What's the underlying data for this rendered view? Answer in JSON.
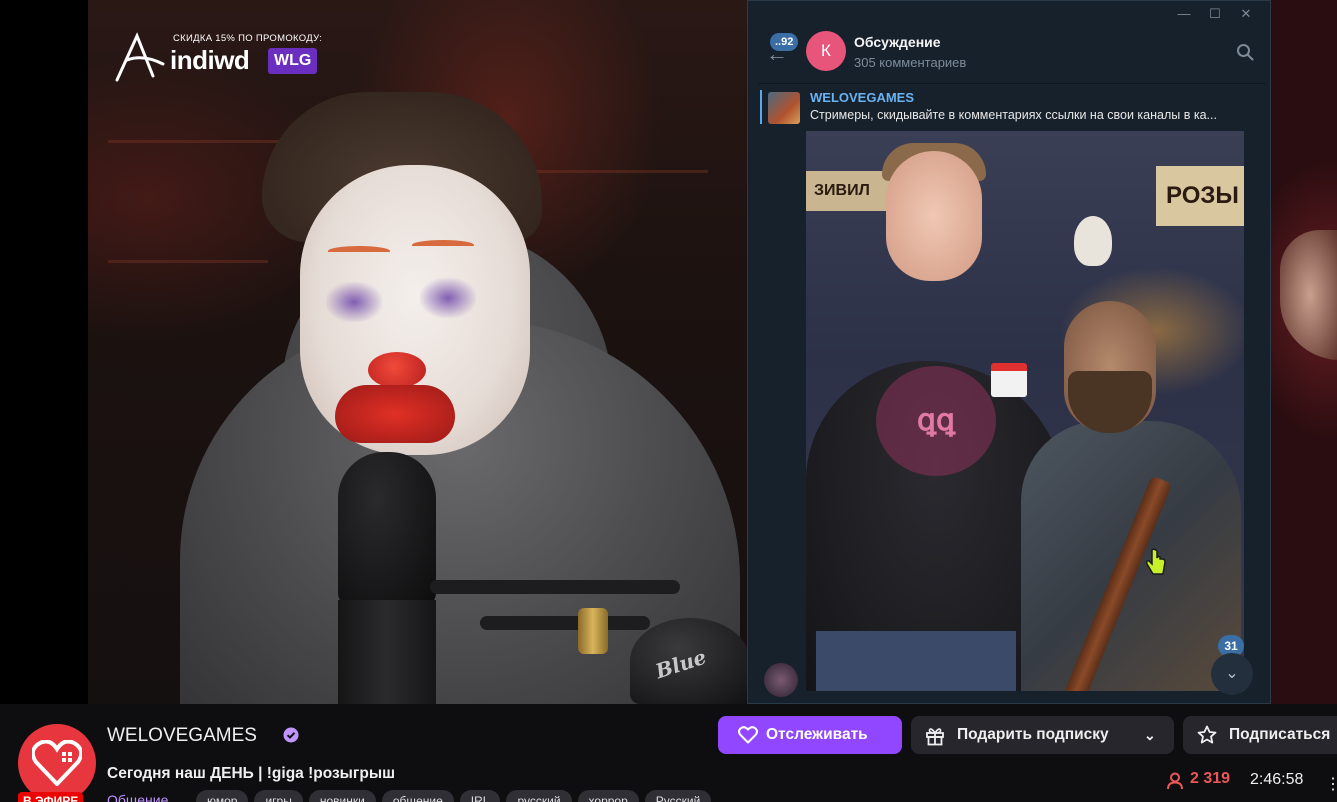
{
  "promo": {
    "top_text": "СКИДКА 15% ПО ПРОМОКОДУ:",
    "brand": "indiwd",
    "code": "WLG"
  },
  "telegram": {
    "unread_badge": "..92",
    "avatar_letter": "К",
    "chat_title": "Обсуждение",
    "chat_subtitle": "305 комментариев",
    "pinned_name": "WELOVEGAMES",
    "pinned_text": "Стримеры, скидывайте в комментариях ссылки на свои каналы в ка...",
    "photo_sign": "РОЗЫ",
    "photo_sign2": "ЗИВИЛ",
    "scroll_badge": "31"
  },
  "channel": {
    "name": "WELOVEGAMES",
    "live_label": "В ЭФИРЕ",
    "title": "Сегодня наш ДЕНЬ | !giga !розыгрыш",
    "category": "Общение",
    "tags": [
      "юмор",
      "игры",
      "новинки",
      "общение",
      "IRL",
      "русский",
      "хоррор",
      "Русский"
    ]
  },
  "actions": {
    "follow": "Отслеживать",
    "gift": "Подарить подписку",
    "subscribe": "Подписаться"
  },
  "stats": {
    "viewers": "2 319",
    "uptime": "2:46:58"
  },
  "colors": {
    "accent": "#9147ff",
    "live": "#eb0400",
    "viewers": "#eb5757",
    "telegram_bg": "#17212b",
    "telegram_link": "#6ab3f3"
  }
}
